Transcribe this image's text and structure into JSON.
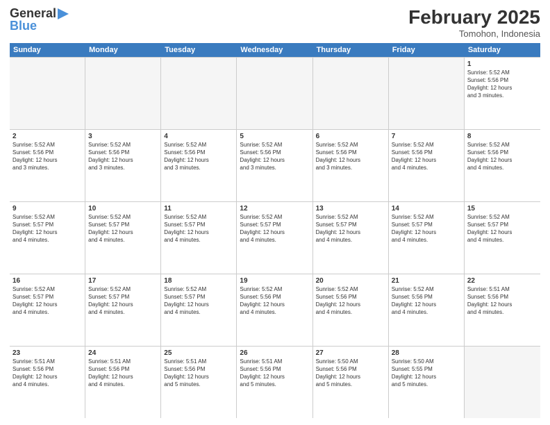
{
  "logo": {
    "line1": "General",
    "line2": "Blue",
    "icon": "▶"
  },
  "title": "February 2025",
  "location": "Tomohon, Indonesia",
  "days_of_week": [
    "Sunday",
    "Monday",
    "Tuesday",
    "Wednesday",
    "Thursday",
    "Friday",
    "Saturday"
  ],
  "weeks": [
    [
      {
        "day": "",
        "info": ""
      },
      {
        "day": "",
        "info": ""
      },
      {
        "day": "",
        "info": ""
      },
      {
        "day": "",
        "info": ""
      },
      {
        "day": "",
        "info": ""
      },
      {
        "day": "",
        "info": ""
      },
      {
        "day": "1",
        "info": "Sunrise: 5:52 AM\nSunset: 5:56 PM\nDaylight: 12 hours\nand 3 minutes."
      }
    ],
    [
      {
        "day": "2",
        "info": "Sunrise: 5:52 AM\nSunset: 5:56 PM\nDaylight: 12 hours\nand 3 minutes."
      },
      {
        "day": "3",
        "info": "Sunrise: 5:52 AM\nSunset: 5:56 PM\nDaylight: 12 hours\nand 3 minutes."
      },
      {
        "day": "4",
        "info": "Sunrise: 5:52 AM\nSunset: 5:56 PM\nDaylight: 12 hours\nand 3 minutes."
      },
      {
        "day": "5",
        "info": "Sunrise: 5:52 AM\nSunset: 5:56 PM\nDaylight: 12 hours\nand 3 minutes."
      },
      {
        "day": "6",
        "info": "Sunrise: 5:52 AM\nSunset: 5:56 PM\nDaylight: 12 hours\nand 3 minutes."
      },
      {
        "day": "7",
        "info": "Sunrise: 5:52 AM\nSunset: 5:56 PM\nDaylight: 12 hours\nand 4 minutes."
      },
      {
        "day": "8",
        "info": "Sunrise: 5:52 AM\nSunset: 5:56 PM\nDaylight: 12 hours\nand 4 minutes."
      }
    ],
    [
      {
        "day": "9",
        "info": "Sunrise: 5:52 AM\nSunset: 5:57 PM\nDaylight: 12 hours\nand 4 minutes."
      },
      {
        "day": "10",
        "info": "Sunrise: 5:52 AM\nSunset: 5:57 PM\nDaylight: 12 hours\nand 4 minutes."
      },
      {
        "day": "11",
        "info": "Sunrise: 5:52 AM\nSunset: 5:57 PM\nDaylight: 12 hours\nand 4 minutes."
      },
      {
        "day": "12",
        "info": "Sunrise: 5:52 AM\nSunset: 5:57 PM\nDaylight: 12 hours\nand 4 minutes."
      },
      {
        "day": "13",
        "info": "Sunrise: 5:52 AM\nSunset: 5:57 PM\nDaylight: 12 hours\nand 4 minutes."
      },
      {
        "day": "14",
        "info": "Sunrise: 5:52 AM\nSunset: 5:57 PM\nDaylight: 12 hours\nand 4 minutes."
      },
      {
        "day": "15",
        "info": "Sunrise: 5:52 AM\nSunset: 5:57 PM\nDaylight: 12 hours\nand 4 minutes."
      }
    ],
    [
      {
        "day": "16",
        "info": "Sunrise: 5:52 AM\nSunset: 5:57 PM\nDaylight: 12 hours\nand 4 minutes."
      },
      {
        "day": "17",
        "info": "Sunrise: 5:52 AM\nSunset: 5:57 PM\nDaylight: 12 hours\nand 4 minutes."
      },
      {
        "day": "18",
        "info": "Sunrise: 5:52 AM\nSunset: 5:57 PM\nDaylight: 12 hours\nand 4 minutes."
      },
      {
        "day": "19",
        "info": "Sunrise: 5:52 AM\nSunset: 5:56 PM\nDaylight: 12 hours\nand 4 minutes."
      },
      {
        "day": "20",
        "info": "Sunrise: 5:52 AM\nSunset: 5:56 PM\nDaylight: 12 hours\nand 4 minutes."
      },
      {
        "day": "21",
        "info": "Sunrise: 5:52 AM\nSunset: 5:56 PM\nDaylight: 12 hours\nand 4 minutes."
      },
      {
        "day": "22",
        "info": "Sunrise: 5:51 AM\nSunset: 5:56 PM\nDaylight: 12 hours\nand 4 minutes."
      }
    ],
    [
      {
        "day": "23",
        "info": "Sunrise: 5:51 AM\nSunset: 5:56 PM\nDaylight: 12 hours\nand 4 minutes."
      },
      {
        "day": "24",
        "info": "Sunrise: 5:51 AM\nSunset: 5:56 PM\nDaylight: 12 hours\nand 4 minutes."
      },
      {
        "day": "25",
        "info": "Sunrise: 5:51 AM\nSunset: 5:56 PM\nDaylight: 12 hours\nand 5 minutes."
      },
      {
        "day": "26",
        "info": "Sunrise: 5:51 AM\nSunset: 5:56 PM\nDaylight: 12 hours\nand 5 minutes."
      },
      {
        "day": "27",
        "info": "Sunrise: 5:50 AM\nSunset: 5:56 PM\nDaylight: 12 hours\nand 5 minutes."
      },
      {
        "day": "28",
        "info": "Sunrise: 5:50 AM\nSunset: 5:55 PM\nDaylight: 12 hours\nand 5 minutes."
      },
      {
        "day": "",
        "info": ""
      }
    ]
  ]
}
